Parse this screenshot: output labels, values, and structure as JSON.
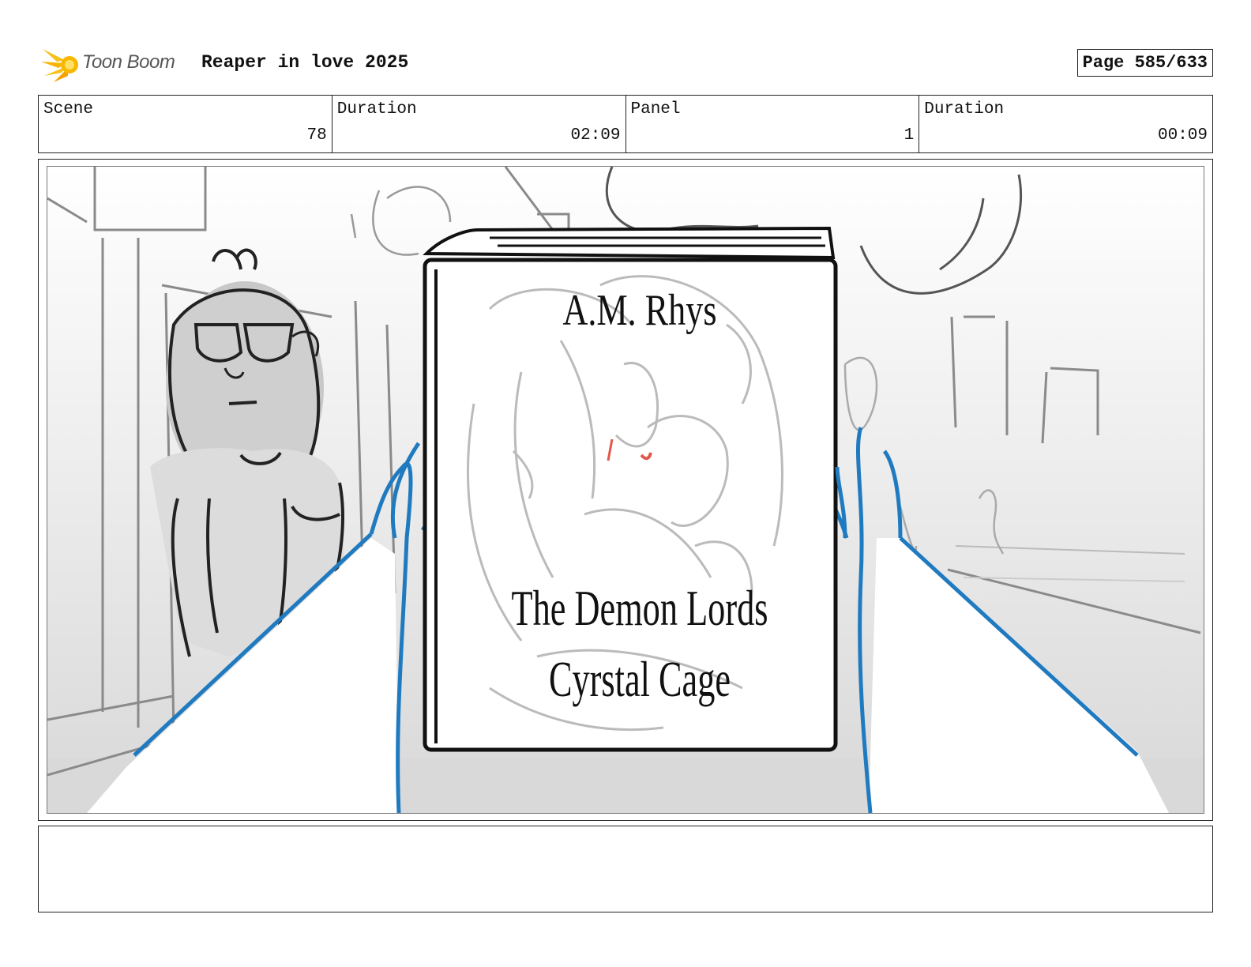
{
  "header": {
    "logo_text": "Toon Boom",
    "project_title": "Reaper in love 2025",
    "page_label": "Page 585/633"
  },
  "info": {
    "scene_label": "Scene",
    "scene_value": "78",
    "scene_duration_label": "Duration",
    "scene_duration_value": "02:09",
    "panel_label": "Panel",
    "panel_value": "1",
    "panel_duration_label": "Duration",
    "panel_duration_value": "00:09"
  },
  "book": {
    "author": "A.M. Rhys",
    "title_line1": "The Demon Lords",
    "title_line2": "Cyrstal Cage"
  },
  "notes": {
    "text": ""
  },
  "colors": {
    "logo_accent": "#f6c21a",
    "hand_stroke": "#1f7ac0",
    "lip_red": "#e2574c"
  }
}
